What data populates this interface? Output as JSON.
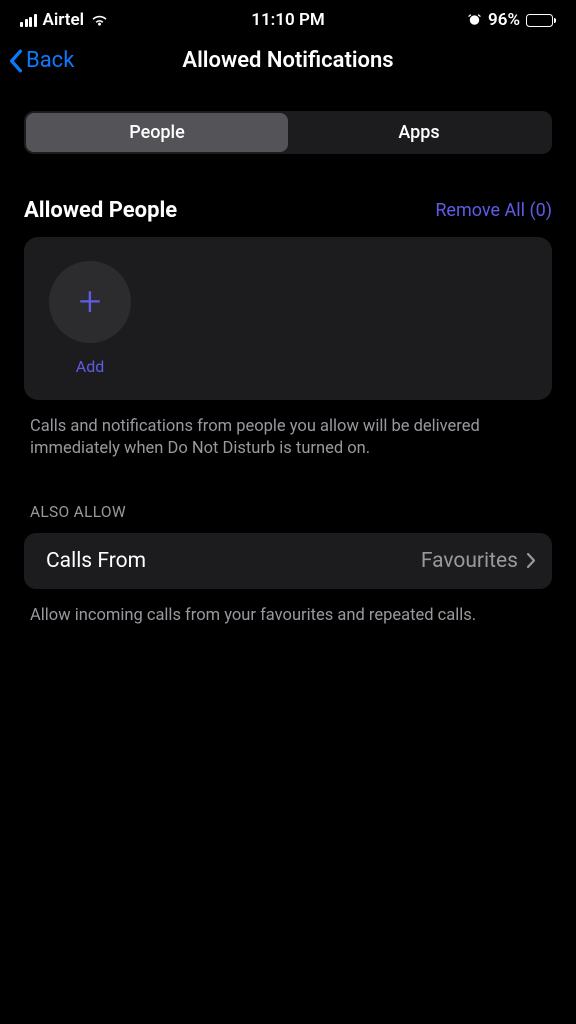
{
  "statusBar": {
    "carrier": "Airtel",
    "time": "11:10 PM",
    "batteryPercent": "96%"
  },
  "nav": {
    "back": "Back",
    "title": "Allowed Notifications"
  },
  "tabs": {
    "people": "People",
    "apps": "Apps"
  },
  "allowedPeople": {
    "title": "Allowed People",
    "removeAll": "Remove All (0)",
    "addLabel": "Add",
    "description": "Calls and notifications from people you allow will be delivered immediately when Do Not Disturb is turned on."
  },
  "alsoAllow": {
    "header": "ALSO ALLOW",
    "callsFrom": {
      "label": "Calls From",
      "value": "Favourites"
    },
    "description": "Allow incoming calls from your favourites and repeated calls."
  }
}
